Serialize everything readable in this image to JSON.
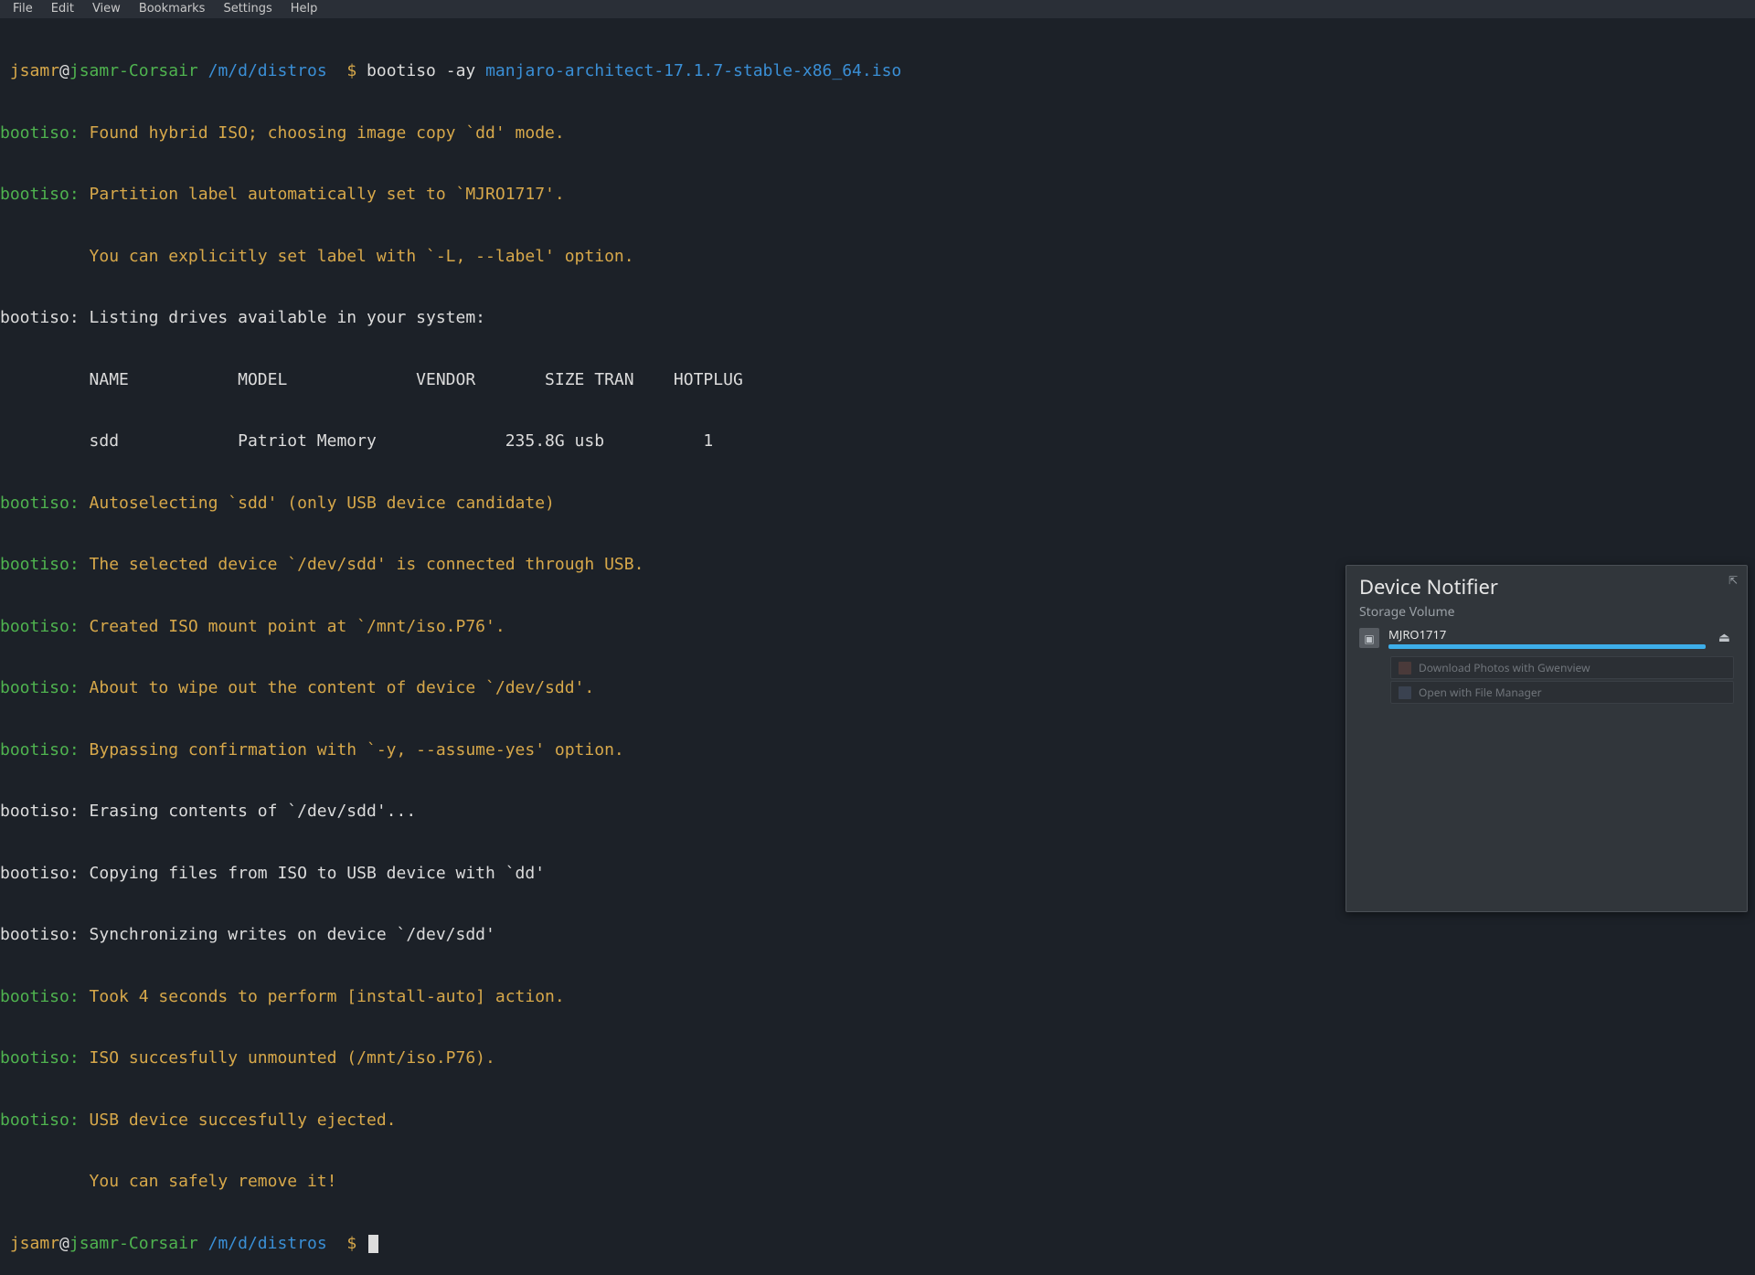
{
  "menubar": {
    "items": [
      "File",
      "Edit",
      "View",
      "Bookmarks",
      "Settings",
      "Help"
    ]
  },
  "prompt": {
    "user": "jsamr",
    "at": "@",
    "host": "jsamr-Corsair",
    "path": "/m/d/distros",
    "dollar": "$"
  },
  "cmd": {
    "bin": "bootiso",
    "flags": "-ay",
    "arg": "manjaro-architect-17.1.7-stable-x86_64.iso"
  },
  "out": {
    "prefix": "bootiso:",
    "l1": "Found hybrid ISO; choosing image copy `dd' mode.",
    "l2": "Partition label automatically set to `MJRO1717'.",
    "l2b": "You can explicitly set label with `-L, --label' option.",
    "l3": "Listing drives available in your system:",
    "hdr": "NAME           MODEL             VENDOR       SIZE TRAN    HOTPLUG",
    "row": "sdd            Patriot Memory             235.8G usb          1",
    "l4": "Autoselecting `sdd' (only USB device candidate)",
    "l5": "The selected device `/dev/sdd' is connected through USB.",
    "l6": "Created ISO mount point at `/mnt/iso.P76'.",
    "l7": "About to wipe out the content of device `/dev/sdd'.",
    "l8": "Bypassing confirmation with `-y, --assume-yes' option.",
    "l9": "Erasing contents of `/dev/sdd'...",
    "l10": "Copying files from ISO to USB device with `dd'",
    "l11": "Synchronizing writes on device `/dev/sdd'",
    "l12": "Took 4 seconds to perform [install-auto] action.",
    "l13": "ISO succesfully unmounted (/mnt/iso.P76).",
    "l14": "USB device succesfully ejected.",
    "l14b": "You can safely remove it!"
  },
  "popup": {
    "title": "Device Notifier",
    "subhead": "Storage Volume",
    "device_name": "MJRO1717",
    "progress_pct": 100,
    "actions": {
      "gwenview": "Download Photos with Gwenview",
      "filemanager": "Open with File Manager"
    }
  }
}
